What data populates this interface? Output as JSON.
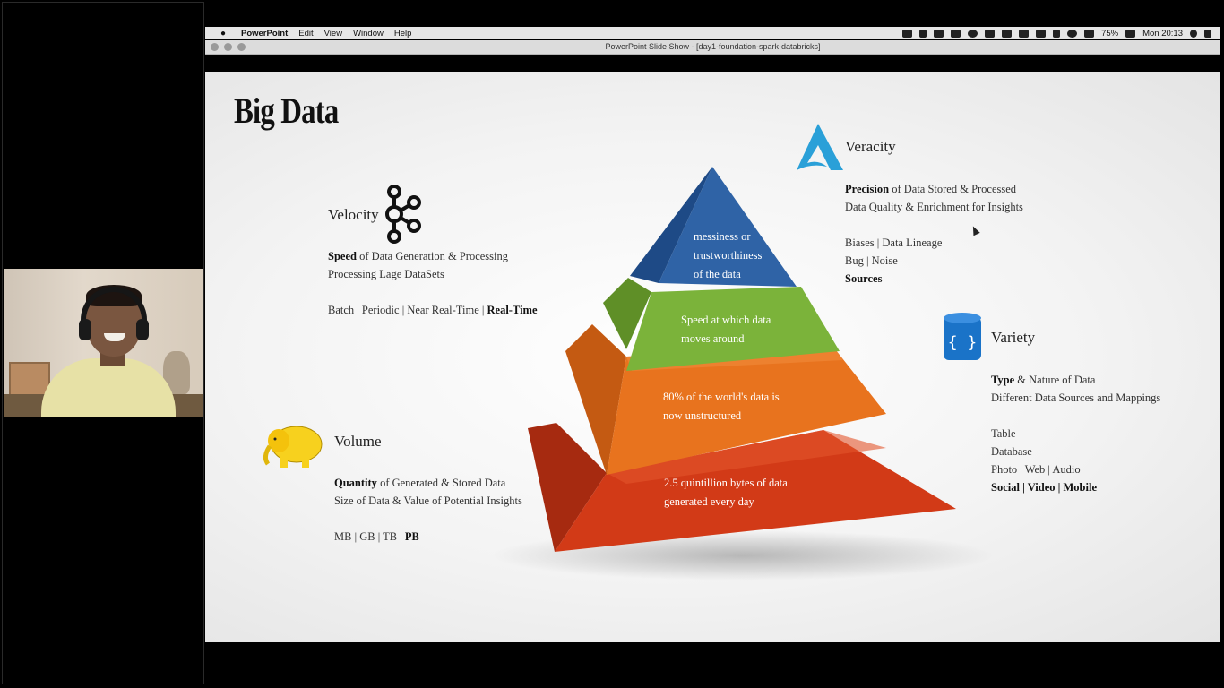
{
  "menubar": {
    "apple": "",
    "items": [
      "PowerPoint",
      "Edit",
      "View",
      "Window",
      "Help"
    ],
    "battery": "75%",
    "clock": "Mon 20:13"
  },
  "window": {
    "title": "PowerPoint Slide Show - [day1-foundation-spark-databricks]"
  },
  "slide": {
    "title": "Big Data",
    "velocity": {
      "title": "Velocity",
      "line1_bold": "Speed",
      "line1_rest": " of Data Generation & Processing",
      "line2": "Processing Lage DataSets",
      "line3": "Batch | Periodic | Near Real-Time | ",
      "line3_bold": "Real-Time"
    },
    "volume": {
      "title": "Volume",
      "line1_bold": "Quantity",
      "line1_rest": " of Generated & Stored Data",
      "line2": "Size of Data & Value of Potential Insights",
      "line3": "MB | GB | TB | ",
      "line3_bold": "PB"
    },
    "veracity": {
      "title": "Veracity",
      "line1_bold": "Precision",
      "line1_rest": " of Data Stored & Processed",
      "line2": "Data Quality & Enrichment for Insights",
      "line3": "Biases | Data Lineage",
      "line4": "Bug | Noise",
      "line5_bold": "Sources"
    },
    "variety": {
      "title": "Variety",
      "line1_bold": "Type",
      "line1_rest": " & Nature of Data",
      "line2": "Different Data Sources and Mappings",
      "line3": "Table",
      "line4": "Database",
      "line5": "Photo | Web | Audio",
      "line6_bold": "Social | Video | Mobile"
    },
    "pyramid": {
      "top_l1": "messiness or",
      "top_l2": "trustworthiness",
      "top_l3": "of the data",
      "green_l1": "Speed at which data",
      "green_l2": "moves around",
      "orange_l1": "80% of the world's data is",
      "orange_l2": "now unstructured",
      "red_l1": "2.5 quintillion bytes of data",
      "red_l2": "generated every day"
    }
  },
  "colors": {
    "pyramid_blue": "#2f63a6",
    "pyramid_green": "#7bb33a",
    "pyramid_orange": "#e8731e",
    "pyramid_red": "#d23a17",
    "veracity_logo": "#2aa0d8",
    "variety_logo": "#1a73c8",
    "hadoop_yellow": "#f7d11e"
  }
}
